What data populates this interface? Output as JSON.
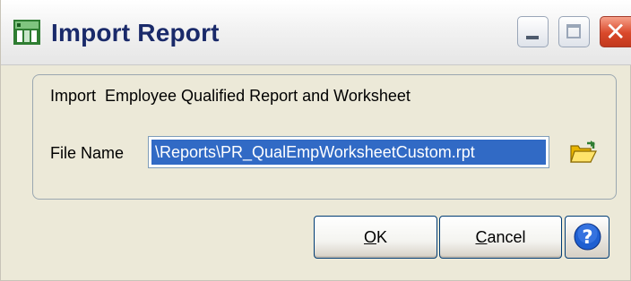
{
  "window": {
    "title": "Import Report",
    "icon": "app-icon",
    "controls": {
      "minimize": "minimize-icon",
      "maximize": "maximize-icon",
      "close": "close-icon"
    }
  },
  "group": {
    "label": "Import  Employee Qualified Report and Worksheet"
  },
  "file_name": {
    "label": "File Name",
    "value": "\\Reports\\PR_QualEmpWorksheetCustom.rpt",
    "browse_icon": "folder-open-icon"
  },
  "buttons": {
    "ok": {
      "key": "O",
      "rest": "K"
    },
    "cancel": {
      "key": "C",
      "rest": "ancel"
    },
    "help_icon": "help-icon"
  },
  "colors": {
    "title": "#1a2a6a",
    "selection": "#316ac5",
    "dialog_background": "#ece9d8",
    "close_button": "#d9482a",
    "help_blue": "#1f5fd1"
  }
}
